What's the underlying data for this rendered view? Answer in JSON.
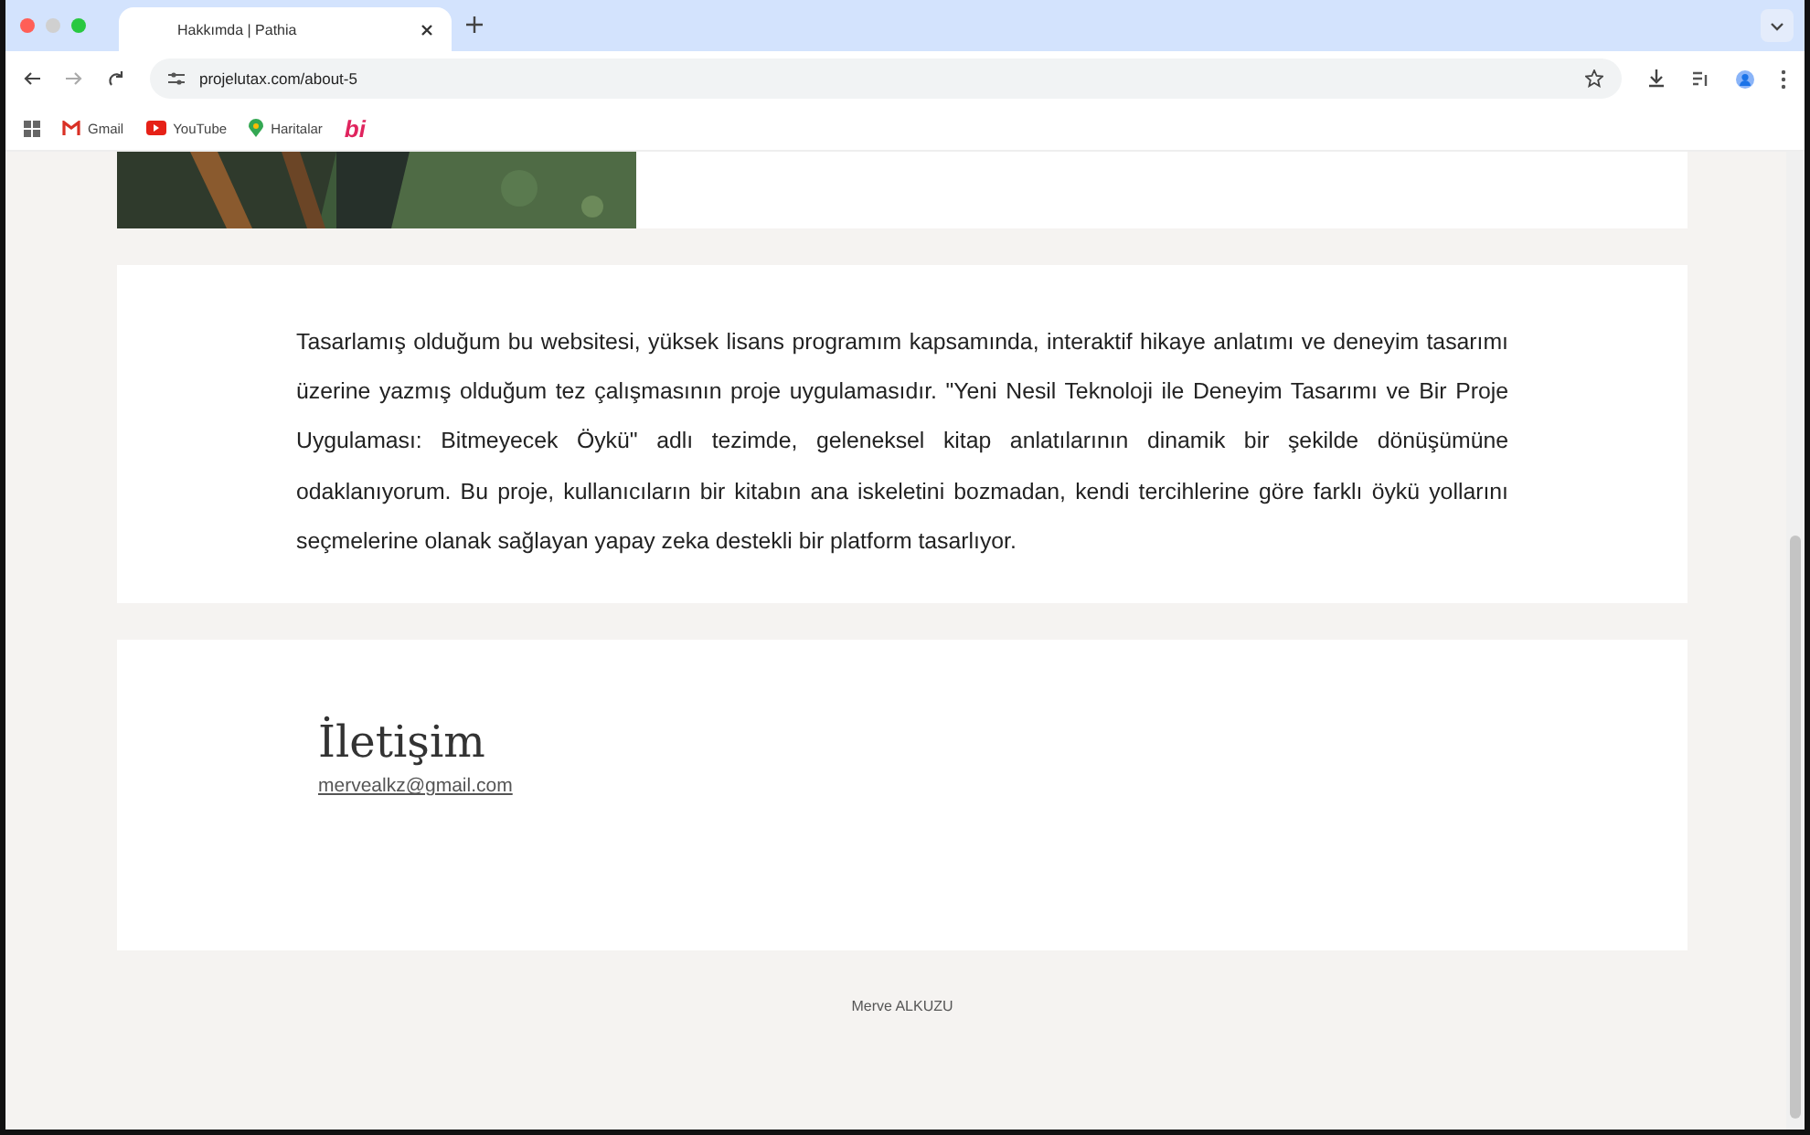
{
  "browser": {
    "tab": {
      "title": "Hakkımda | Pathia",
      "selected": true
    },
    "url": "projelutax.com/about-5",
    "bookmarks": [
      {
        "kind": "gmail",
        "label": "Gmail"
      },
      {
        "kind": "youtube",
        "label": "YouTube"
      },
      {
        "kind": "maps",
        "label": "Haritalar"
      },
      {
        "kind": "logo",
        "label": "bi"
      }
    ]
  },
  "page": {
    "about": {
      "paragraph": "Tasarlamış olduğum bu websitesi, yüksek lisans programım kapsamında, interaktif hikaye anlatımı ve deneyim tasarımı üzerine yazmış olduğum tez çalışmasının proje uygulamasıdır. \"Yeni Nesil Teknoloji ile Deneyim Tasarımı ve Bir Proje Uygulaması: Bitmeyecek Öykü\" adlı tezimde, geleneksel kitap anlatılarının dinamik bir şekilde dönüşümüne odaklanıyorum. Bu proje, kullanıcıların bir kitabın ana iskeletini bozmadan, kendi tercihlerine göre farklı öykü yollarını seçmelerine olanak sağlayan yapay zeka destekli bir platform tasarlıyor."
    },
    "contact": {
      "heading": "İletişim",
      "email": "mervealkz@gmail.com"
    },
    "footer": "Merve ALKUZU"
  }
}
